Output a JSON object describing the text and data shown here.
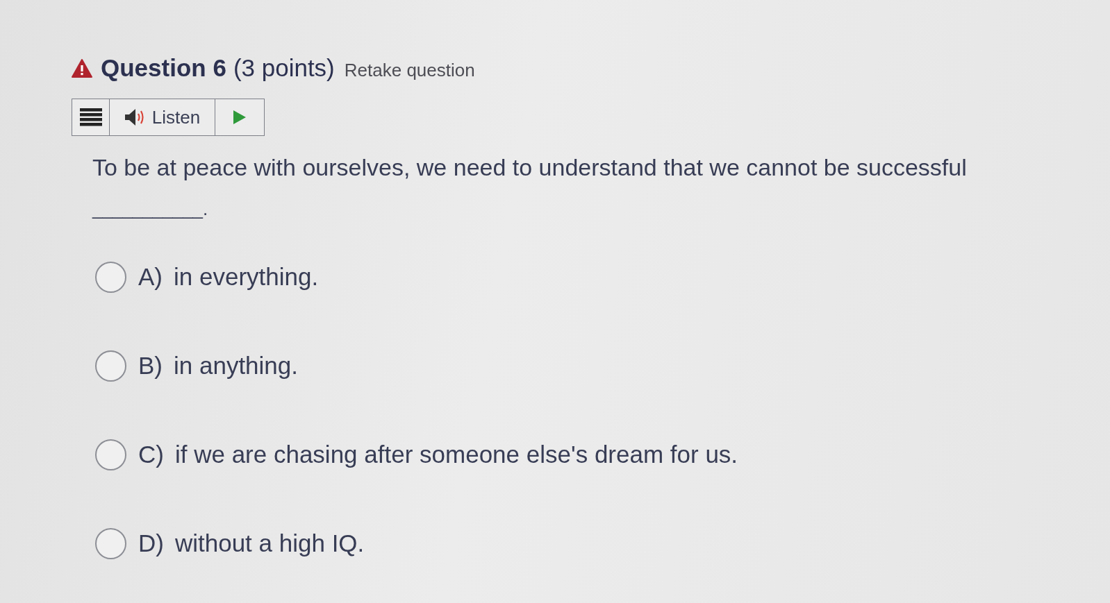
{
  "question": {
    "title": "Question 6",
    "points": "(3 points)",
    "retake": "Retake question"
  },
  "toolbar": {
    "listen": "Listen"
  },
  "prompt": "To be at peace with ourselves, we need to understand that we cannot be successful",
  "blank": "___________.",
  "options": [
    {
      "letter": "A)",
      "text": "in everything.",
      "selected": false
    },
    {
      "letter": "B)",
      "text": "in anything.",
      "selected": false
    },
    {
      "letter": "C)",
      "text": "if we are chasing after someone else's dream for us.",
      "selected": false
    },
    {
      "letter": "D)",
      "text": "without a high IQ.",
      "selected": false
    }
  ]
}
